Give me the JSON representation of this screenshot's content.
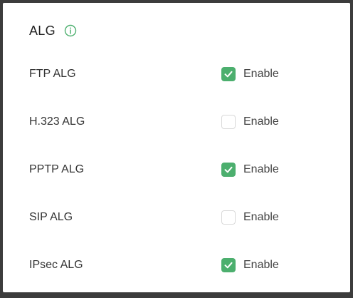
{
  "section": {
    "title": "ALG",
    "info_icon": "info-icon",
    "accent_color": "#4caf6e"
  },
  "rows": [
    {
      "label": "FTP ALG",
      "checkbox_label": "Enable",
      "checked": true
    },
    {
      "label": "H.323 ALG",
      "checkbox_label": "Enable",
      "checked": false
    },
    {
      "label": "PPTP ALG",
      "checkbox_label": "Enable",
      "checked": true
    },
    {
      "label": "SIP ALG",
      "checkbox_label": "Enable",
      "checked": false
    },
    {
      "label": "IPsec ALG",
      "checkbox_label": "Enable",
      "checked": true
    }
  ]
}
